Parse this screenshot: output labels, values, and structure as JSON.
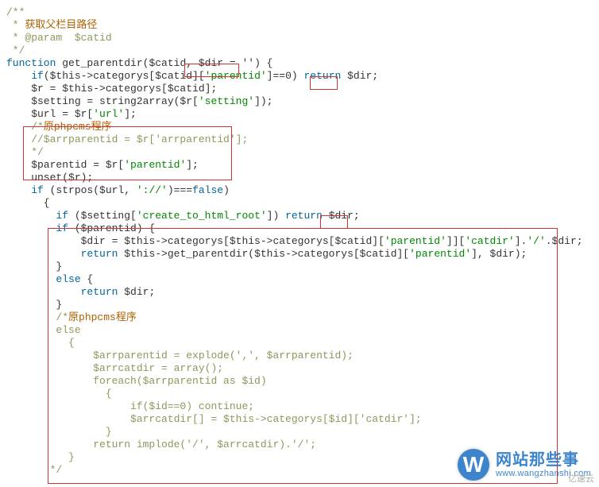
{
  "code": {
    "l01": "/**",
    "l02_a": " * ",
    "l02_b": "获取父栏目路径",
    "l03": " * @param  $catid",
    "l04": " */",
    "l05_a": "function",
    "l05_b": " get_parentdir($catid, ",
    "l05_c": "$dir = ''",
    "l05_d": ") {",
    "l06_a": "    if",
    "l06_b": "($this->categorys[$catid][",
    "l06_c": "'parentid'",
    "l06_d": "]==0) ",
    "l06_e": "return",
    "l06_f": " ",
    "l06_g": "$dir",
    "l06_h": ";",
    "l07_a": "    $r = $this->categorys[$catid];",
    "l08_a": "    $setting = string2array($r[",
    "l08_b": "'setting'",
    "l08_c": "]);",
    "l09_a": "    $url = $r[",
    "l09_b": "'url'",
    "l09_c": "];",
    "l10_a": "    /*",
    "l10_b": "原phpcms程序",
    "l11": "    //$arrparentid = $r['arrparentid'];",
    "l12": "    */",
    "l13_a": "    $parentid = $r[",
    "l13_b": "'parentid'",
    "l13_c": "];",
    "l14": "    unset($r);",
    "l15_a": "    if",
    "l15_b": " (strpos($url, ",
    "l15_c": "'://'",
    "l15_d": ")===",
    "l15_e": "false",
    "l15_f": ")",
    "l16": "      {",
    "l17_a": "        if",
    "l17_b": " ($setting[",
    "l17_c": "'create_to_html_root'",
    "l17_d": "]) ",
    "l17_e": "return",
    "l17_f": " ",
    "l17_g": "$dir",
    "l17_h": ";",
    "l18_a": "        if",
    "l18_b": " ($parentid) {",
    "l19_a": "            $dir = $this->categorys[$this->categorys[$catid][",
    "l19_b": "'parentid'",
    "l19_c": "]][",
    "l19_d": "'catdir'",
    "l19_e": "].",
    "l19_f": "'/'",
    "l19_g": ".$dir;",
    "l20_a": "            return",
    "l20_b": " $this->get_parentdir($this->categorys[$catid][",
    "l20_c": "'parentid'",
    "l20_d": "], $dir);",
    "l21": "        }",
    "l22_a": "        else",
    "l22_b": " {",
    "l23_a": "            return",
    "l23_b": " $dir;",
    "l24": "        }",
    "l25_a": "        /*",
    "l25_b": "原phpcms程序",
    "l26": "        else",
    "l27": "          {",
    "l28": "              $arrparentid = explode(',', $arrparentid);",
    "l29": "              $arrcatdir = array();",
    "l30": "              foreach($arrparentid as $id)",
    "l31": "                {",
    "l32": "                    if($id==0) continue;",
    "l33": "                    $arrcatdir[] = $this->categorys[$id]['catdir'];",
    "l34": "                }",
    "l35": "              return implode('/', $arrcatdir).'/';",
    "l36": "          }",
    "l37": "       */"
  },
  "watermark": {
    "badge_letter": "W",
    "cn": "网站那些事",
    "en": "www.wangzhanshi.com"
  },
  "corner_credit": "亿速云"
}
